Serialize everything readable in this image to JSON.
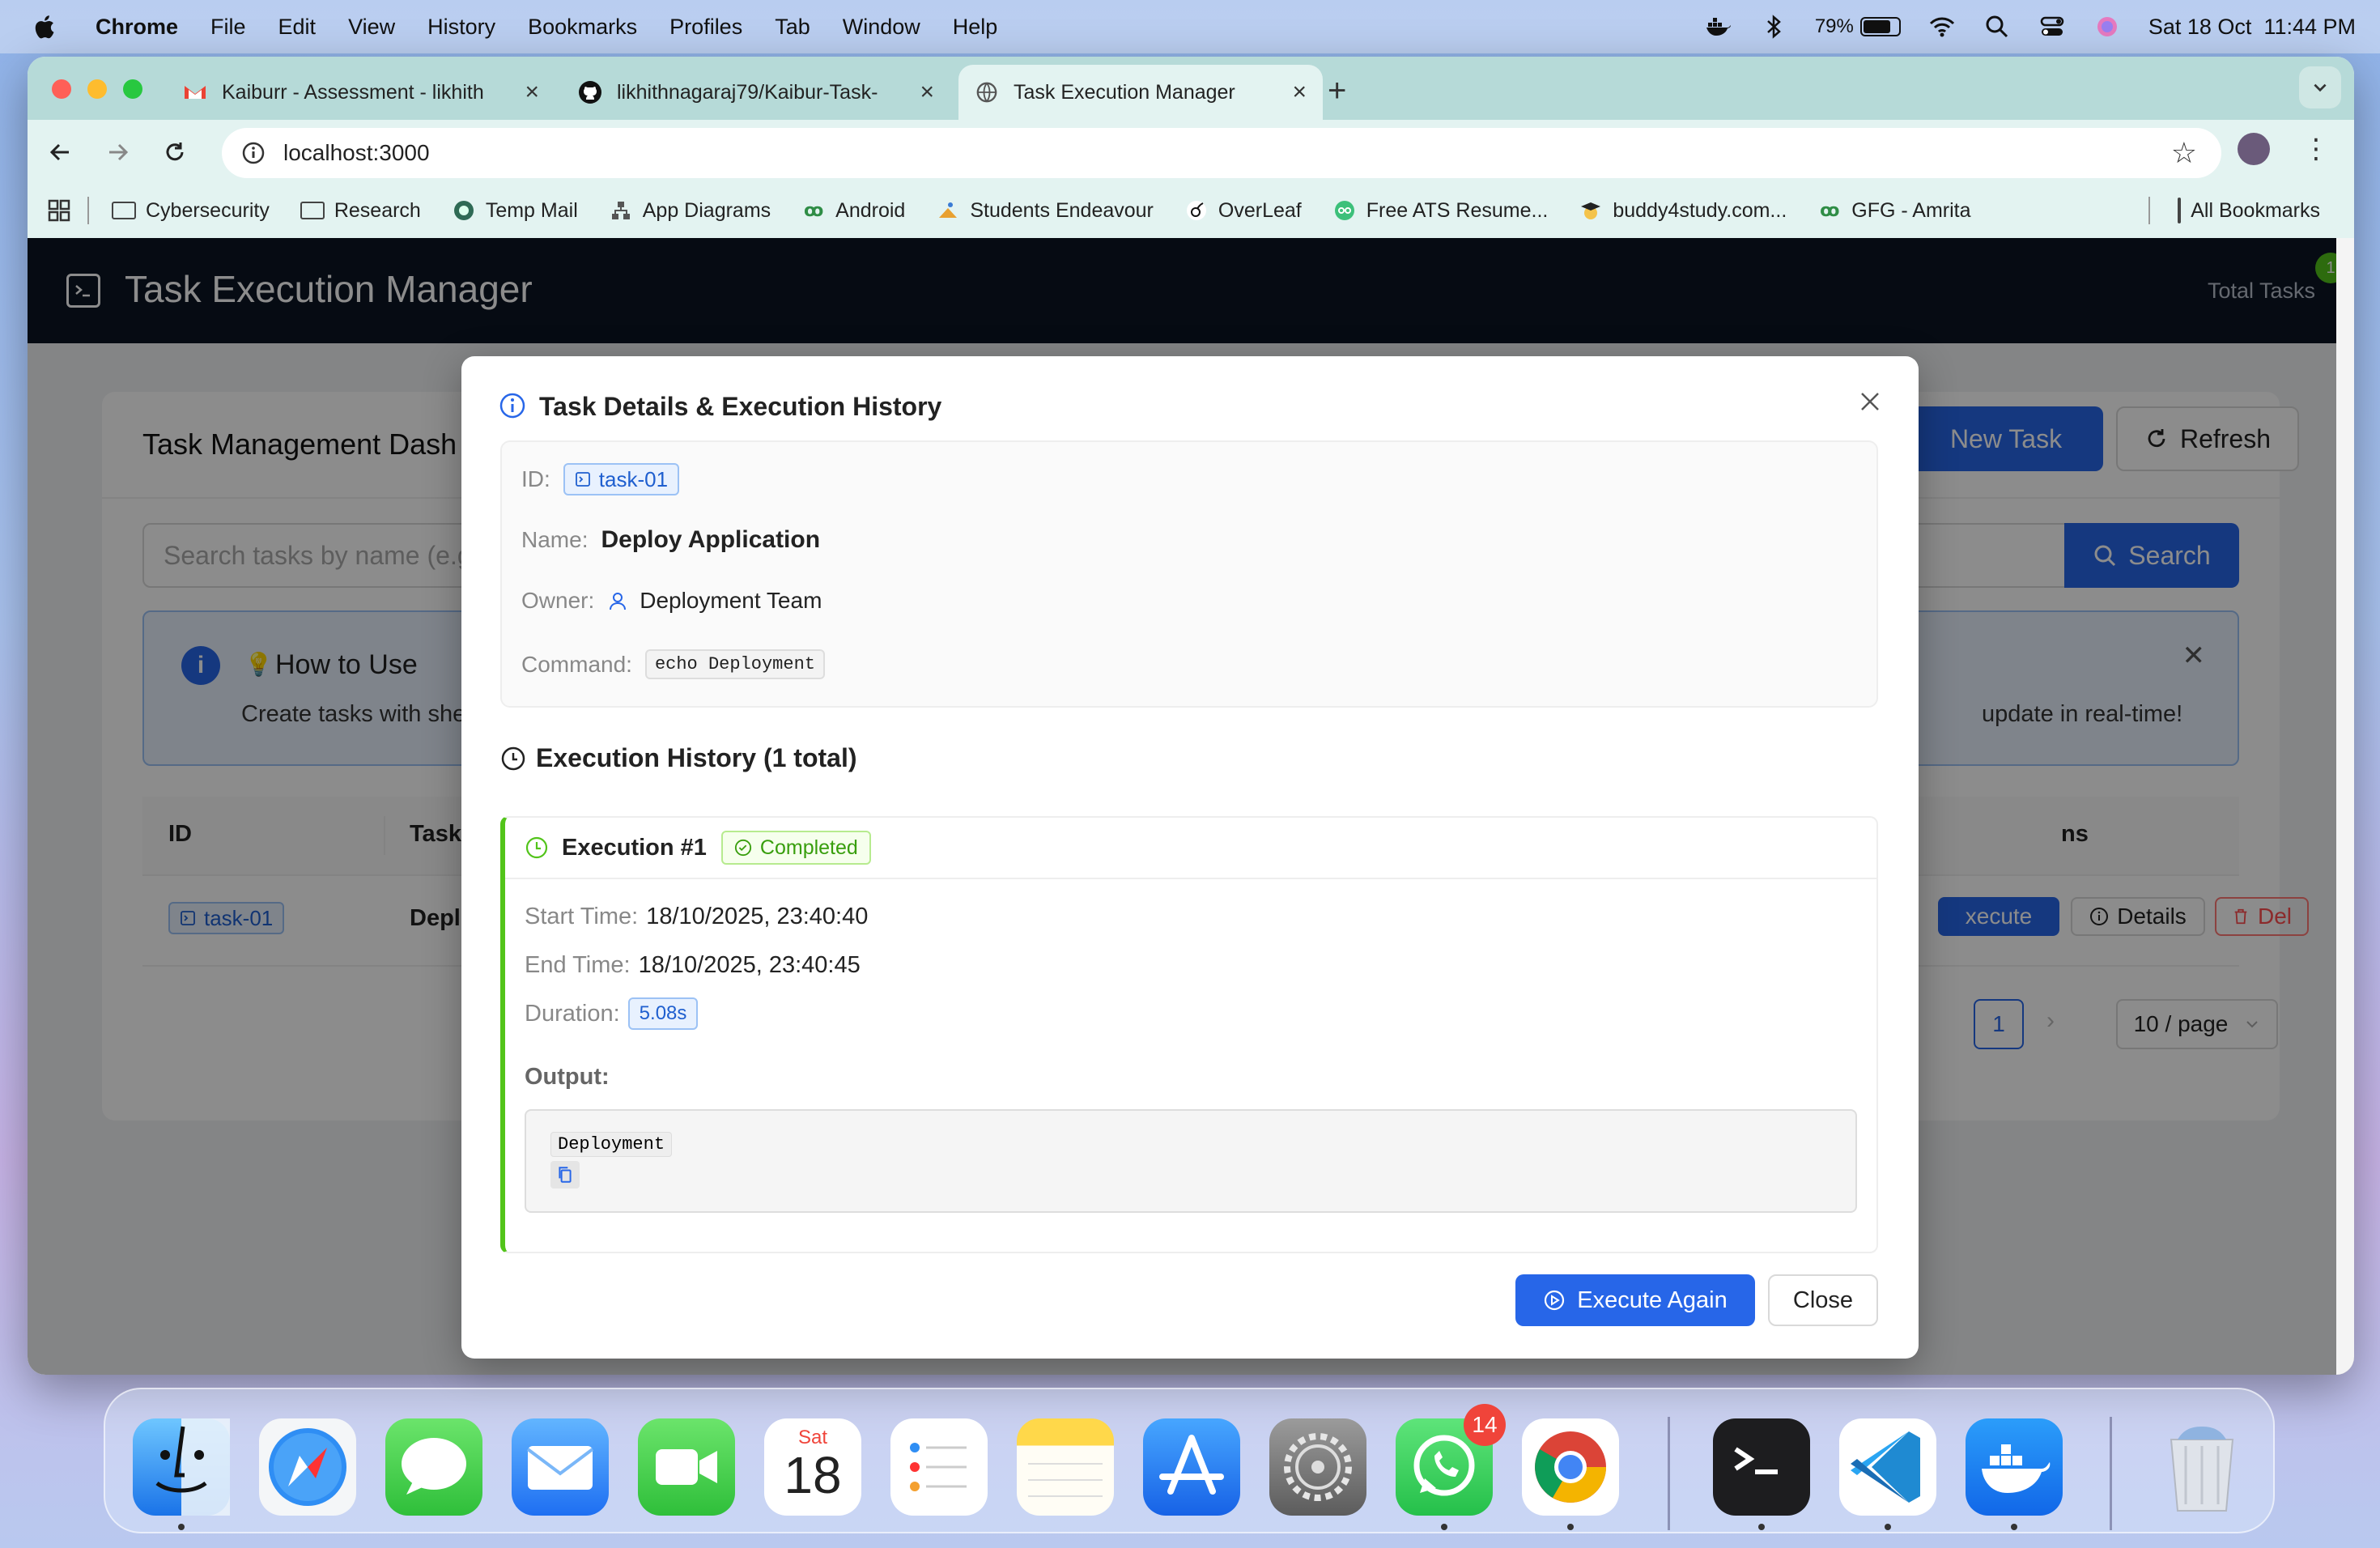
{
  "menubar": {
    "app_name": "Chrome",
    "items": [
      "File",
      "Edit",
      "View",
      "History",
      "Bookmarks",
      "Profiles",
      "Tab",
      "Window",
      "Help"
    ],
    "battery_percent": "79%",
    "battery_level": 0.79,
    "datetime": "Sat 18 Oct  11:44 PM"
  },
  "browser": {
    "tabs": [
      {
        "title": "Kaiburr - Assessment - likhith",
        "icon": "gmail-icon"
      },
      {
        "title": "likhithnagaraj79/Kaibur-Task-",
        "icon": "github-icon"
      },
      {
        "title": "Task Execution Manager",
        "icon": "globe-icon",
        "active": true
      }
    ],
    "url": "localhost:3000",
    "bookmarks": [
      {
        "label": "Cybersecurity",
        "icon": "folder-icon"
      },
      {
        "label": "Research",
        "icon": "folder-icon"
      },
      {
        "label": "Temp Mail",
        "icon": "tempmail-icon"
      },
      {
        "label": "App Diagrams",
        "icon": "diagram-icon"
      },
      {
        "label": "Android",
        "icon": "android-icon"
      },
      {
        "label": "Students Endeavour",
        "icon": "endeavour-icon"
      },
      {
        "label": "OverLeaf",
        "icon": "overleaf-icon"
      },
      {
        "label": "Free ATS Resume...",
        "icon": "ats-icon"
      },
      {
        "label": "buddy4study.com...",
        "icon": "graduation-icon"
      },
      {
        "label": "GFG - Amrita",
        "icon": "gfg-icon"
      }
    ],
    "all_bookmarks": "All Bookmarks"
  },
  "app": {
    "title": "Task Execution Manager",
    "total_tasks_label": "Total Tasks",
    "total_tasks_count": "1",
    "dashboard_title": "Task Management Dash",
    "new_task_label": "New Task",
    "refresh_label": "Refresh",
    "search_placeholder": "Search tasks by name (e.g",
    "search_button": "Search",
    "howto_title": "How to Use",
    "howto_text_left": "Create tasks with she",
    "howto_text_right": "update in real-time!",
    "table_headers": [
      "ID",
      "Task",
      "ns"
    ],
    "row": {
      "id": "task-01",
      "name": "Depl",
      "execute": "xecute",
      "details": "Details",
      "delete": "Del"
    },
    "pager_page": "1",
    "page_size": "10 / page"
  },
  "modal": {
    "title": "Task Details & Execution History",
    "id_label": "ID:",
    "id_value": "task-01",
    "name_label": "Name:",
    "name_value": "Deploy Application",
    "owner_label": "Owner:",
    "owner_value": "Deployment Team",
    "command_label": "Command:",
    "command_value": "echo Deployment",
    "history_title": "Execution History (1 total)",
    "execution": {
      "name": "Execution #1",
      "status": "Completed",
      "start_label": "Start Time:",
      "start_value": "18/10/2025, 23:40:40",
      "end_label": "End Time:",
      "end_value": "18/10/2025, 23:40:45",
      "duration_label": "Duration:",
      "duration_value": "5.08s",
      "output_label": "Output:",
      "output_value": "Deployment"
    },
    "execute_again": "Execute Again",
    "close": "Close"
  },
  "dock": {
    "apps": [
      "Finder",
      "Safari",
      "Messages",
      "Mail",
      "FaceTime",
      "Calendar",
      "Reminders",
      "Notes",
      "App Store",
      "System Settings",
      "WhatsApp",
      "Chrome",
      "Terminal",
      "VS Code",
      "Docker",
      "Trash"
    ],
    "calendar_day": "Sat",
    "calendar_date": "18",
    "whatsapp_badge": "14"
  },
  "colors": {
    "primary": "#2766e8",
    "success": "#52c41a",
    "header_bg": "#0c1424",
    "tab_strip": "#b6dad8"
  }
}
